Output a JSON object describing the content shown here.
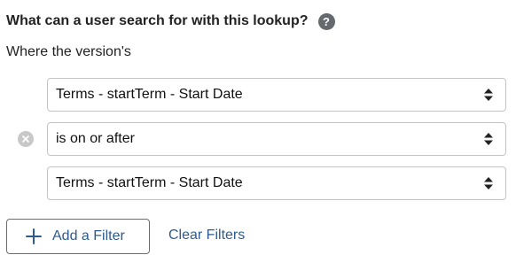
{
  "question": {
    "text": "What can a user search for with this lookup?",
    "help_icon": "question-mark-icon",
    "help_glyph": "?"
  },
  "subheading": "Where the version's",
  "filter": {
    "remove_icon": "remove-circle-icon",
    "field_select": {
      "value": "Terms - startTerm - Start Date",
      "icon": "sort-arrows-icon"
    },
    "operator_select": {
      "value": "is on or after",
      "icon": "sort-arrows-icon"
    },
    "value_select": {
      "value": "Terms - startTerm - Start Date",
      "icon": "sort-arrows-icon"
    }
  },
  "actions": {
    "add_filter_label": "Add a Filter",
    "add_filter_icon": "plus-icon",
    "clear_filters_label": "Clear Filters"
  },
  "colors": {
    "link": "#2e5b8f",
    "help_icon_bg": "#666a6e",
    "remove_icon_bg": "#c8c8c8",
    "select_border": "#c4c4c4",
    "button_border": "#6c6c6c"
  }
}
